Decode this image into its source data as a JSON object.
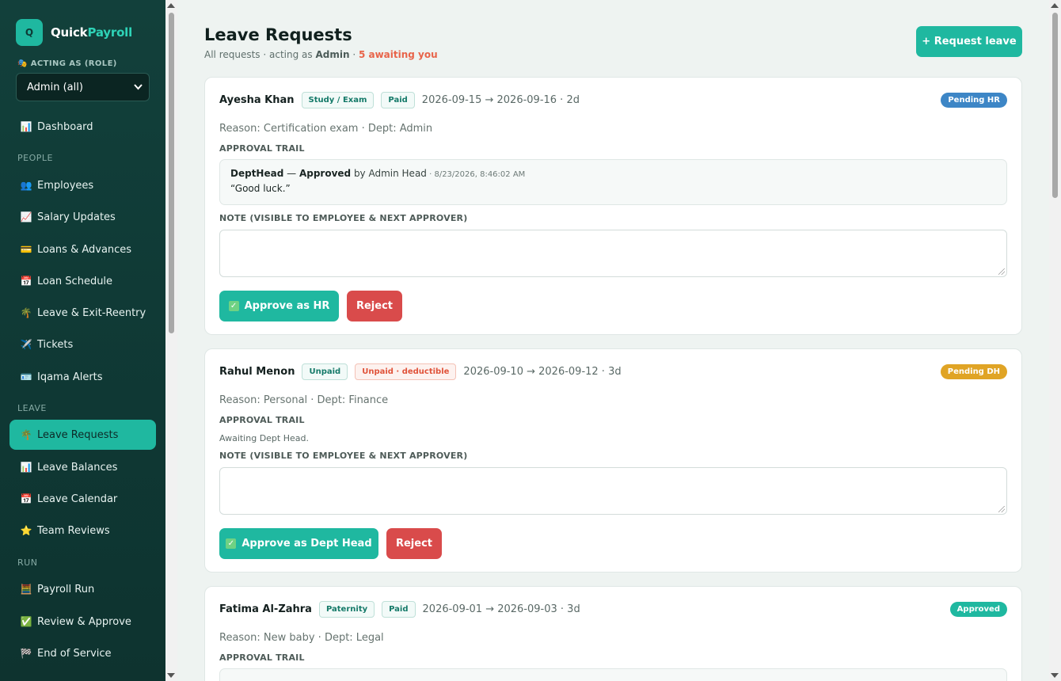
{
  "app": {
    "logo_letter": "Q",
    "name_part1": "Quick",
    "name_part2": "Payroll"
  },
  "role": {
    "label": "🎭 ACTING AS (ROLE)",
    "selected": "Admin (all)"
  },
  "nav": {
    "dashboard": {
      "icon": "📊",
      "label": "Dashboard"
    },
    "people_section": "PEOPLE",
    "employees": {
      "icon": "👥",
      "label": "Employees"
    },
    "salary_updates": {
      "icon": "📈",
      "label": "Salary Updates"
    },
    "loans": {
      "icon": "💳",
      "label": "Loans & Advances"
    },
    "loan_schedule": {
      "icon": "📅",
      "label": "Loan Schedule"
    },
    "leave_exit": {
      "icon": "🌴",
      "label": "Leave & Exit-Reentry"
    },
    "tickets": {
      "icon": "✈️",
      "label": "Tickets"
    },
    "iqama": {
      "icon": "🪪",
      "label": "Iqama Alerts"
    },
    "leave_section": "LEAVE",
    "leave_requests": {
      "icon": "🌴",
      "label": "Leave Requests"
    },
    "leave_balances": {
      "icon": "📊",
      "label": "Leave Balances"
    },
    "leave_calendar": {
      "icon": "📅",
      "label": "Leave Calendar"
    },
    "team_reviews": {
      "icon": "⭐",
      "label": "Team Reviews"
    },
    "run_section": "RUN",
    "payroll_run": {
      "icon": "🧮",
      "label": "Payroll Run"
    },
    "review_approve": {
      "icon": "✅",
      "label": "Review & Approve"
    },
    "end_service": {
      "icon": "🏁",
      "label": "End of Service"
    }
  },
  "page": {
    "title": "Leave Requests",
    "sub_prefix": "All requests · acting as ",
    "sub_role": "Admin",
    "sub_sep": " · ",
    "sub_awaiting": "5 awaiting you",
    "request_button": "+ Request leave"
  },
  "labels": {
    "approval_trail": "APPROVAL TRAIL",
    "note": "NOTE (VISIBLE TO EMPLOYEE & NEXT APPROVER)",
    "reject": "Reject",
    "check": "✓"
  },
  "requests": [
    {
      "name": "Ayesha Khan",
      "tag1": "Study / Exam",
      "tag2": "Paid",
      "dates": "2026-09-15 → 2026-09-16 · 2d",
      "status": "Pending HR",
      "status_color": "#3d86c6",
      "reason": "Reason: Certification exam · Dept: Admin",
      "trail_role": "DeptHead",
      "trail_dash": " — ",
      "trail_action": "Approved",
      "trail_by": " by Admin Head",
      "trail_ts": " · 8/23/2026, 8:46:02 AM",
      "trail_comment": "“Good luck.”",
      "approve_label": "Approve as HR"
    },
    {
      "name": "Rahul Menon",
      "tag1": "Unpaid",
      "tag2": "Unpaid · deductible",
      "dates": "2026-09-10 → 2026-09-12 · 3d",
      "status": "Pending DH",
      "status_color": "#e0a425",
      "reason": "Reason: Personal · Dept: Finance",
      "trail_empty": "Awaiting Dept Head.",
      "approve_label": "Approve as Dept Head"
    },
    {
      "name": "Fatima Al-Zahra",
      "tag1": "Paternity",
      "tag2": "Paid",
      "dates": "2026-09-01 → 2026-09-03 · 3d",
      "status": "Approved",
      "status_color": "#1fb8a0",
      "reason": "Reason: New baby · Dept: Legal"
    }
  ]
}
